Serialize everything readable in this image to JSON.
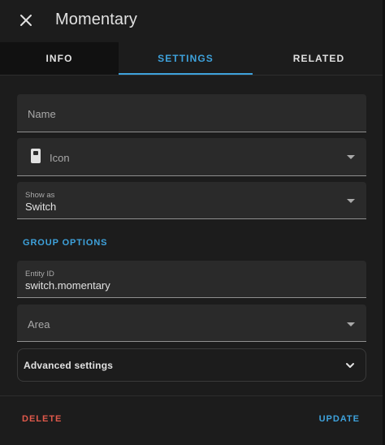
{
  "dialog": {
    "title": "Momentary",
    "close_icon": "close-icon"
  },
  "tabs": [
    {
      "label": "INFO",
      "active": false
    },
    {
      "label": "SETTINGS",
      "active": true
    },
    {
      "label": "RELATED",
      "active": false
    }
  ],
  "fields": {
    "name": {
      "label": "Name"
    },
    "icon": {
      "label": "Icon",
      "leading_icon": "switch-icon",
      "trailing_icon": "dropdown-caret-icon"
    },
    "show_as": {
      "label": "Show as",
      "value": "Switch",
      "trailing_icon": "dropdown-caret-icon"
    },
    "entity_id": {
      "label": "Entity ID",
      "value": "switch.momentary"
    },
    "area": {
      "label": "Area",
      "trailing_icon": "dropdown-caret-icon"
    }
  },
  "group_options": {
    "title": "GROUP OPTIONS"
  },
  "advanced": {
    "label": "Advanced settings",
    "icon": "chevron-down-icon"
  },
  "footer": {
    "delete_label": "DELETE",
    "update_label": "UPDATE"
  },
  "colors": {
    "accent": "#3ea2dc",
    "danger": "#e0594b",
    "surface": "#1c1c1c",
    "field": "#2a2a2a"
  }
}
